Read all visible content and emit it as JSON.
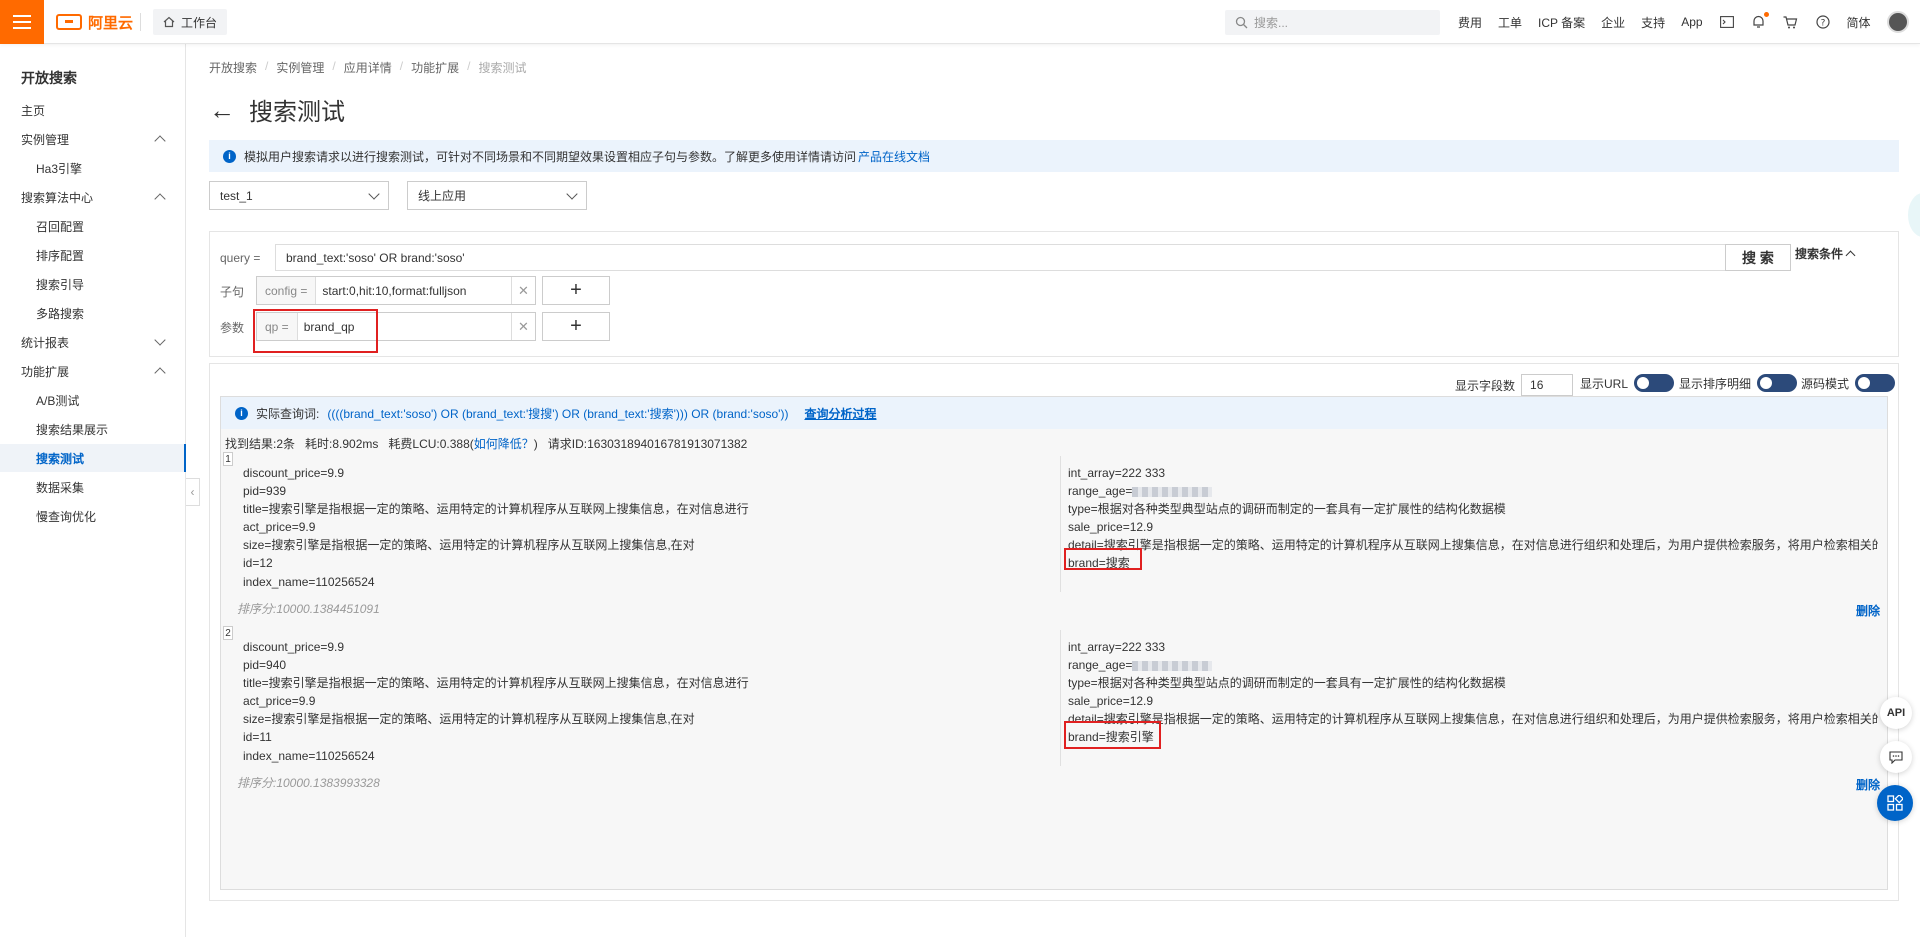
{
  "topbar": {
    "logo_text": "阿里云",
    "workbench_label": "工作台",
    "search_placeholder": "搜索...",
    "links": [
      "费用",
      "工单",
      "ICP 备案",
      "企业",
      "支持",
      "App"
    ],
    "lang": "简体"
  },
  "sidebar": {
    "title": "开放搜索",
    "items": [
      {
        "label": "主页",
        "sub": false,
        "chevron": ""
      },
      {
        "label": "实例管理",
        "sub": false,
        "chevron": "up"
      },
      {
        "label": "Ha3引擎",
        "sub": true,
        "chevron": ""
      },
      {
        "label": "搜索算法中心",
        "sub": false,
        "chevron": "up"
      },
      {
        "label": "召回配置",
        "sub": true,
        "chevron": ""
      },
      {
        "label": "排序配置",
        "sub": true,
        "chevron": ""
      },
      {
        "label": "搜索引导",
        "sub": true,
        "chevron": ""
      },
      {
        "label": "多路搜索",
        "sub": true,
        "chevron": ""
      },
      {
        "label": "统计报表",
        "sub": false,
        "chevron": "down"
      },
      {
        "label": "功能扩展",
        "sub": false,
        "chevron": "up"
      },
      {
        "label": "A/B测试",
        "sub": true,
        "chevron": ""
      },
      {
        "label": "搜索结果展示",
        "sub": true,
        "chevron": ""
      },
      {
        "label": "搜索测试",
        "sub": true,
        "chevron": "",
        "active": true
      },
      {
        "label": "数据采集",
        "sub": true,
        "chevron": ""
      },
      {
        "label": "慢查询优化",
        "sub": true,
        "chevron": ""
      }
    ]
  },
  "breadcrumb": [
    "开放搜索",
    "实例管理",
    "应用详情",
    "功能扩展",
    "搜索测试"
  ],
  "page_title": "搜索测试",
  "notice": {
    "text": "模拟用户搜索请求以进行搜索测试，可针对不同场景和不同期望效果设置相应子句与参数。了解更多使用详情请访问",
    "link": "产品在线文档"
  },
  "selects": {
    "app": "test_1",
    "env": "线上应用"
  },
  "query": {
    "label": "query =",
    "value": "brand_text:'soso' OR brand:'soso'",
    "search_button": "搜 索",
    "conditions_toggle": "搜索条件",
    "clause_label": "子句",
    "clause_key": "config =",
    "clause_value": "start:0,hit:10,format:fulljson",
    "param_label": "参数",
    "param_key": "qp =",
    "param_value": "brand_qp"
  },
  "controls": {
    "fields_label": "显示字段数",
    "fields_value": "16",
    "show_url": "显示URL",
    "show_sort": "显示排序明细",
    "source_mode": "源码模式"
  },
  "results": {
    "actual_query_label": "实际查询词:",
    "actual_query": "((((brand_text:'soso') OR (brand_text:'搜搜') OR (brand_text:'搜索'))) OR (brand:'soso'))",
    "analysis_link": "查询分析过程",
    "found": "找到结果:2条",
    "time": "耗时:8.902ms",
    "lcu_prefix": "耗费LCU:0.388(",
    "lcu_link": "如何降低？",
    "lcu_suffix": ")",
    "request_id": "请求ID:163031894016781913071382",
    "records": [
      {
        "num": "1",
        "left": [
          "discount_price=9.9",
          "pid=939",
          "title=搜索引擎是指根据一定的策略、运用特定的计算机程序从互联网上搜集信息，在对信息进行",
          "act_price=9.9",
          "size=搜索引擎是指根据一定的策略、运用特定的计算机程序从互联网上搜集信息,在对",
          "id=12",
          "index_name=110256524"
        ],
        "right_1": "int_array=222  333",
        "right_2": "range_age=",
        "right_3": "type=根据对各种类型典型站点的调研而制定的一套具有一定扩展性的结构化数据模",
        "right_4": "sale_price=12.9",
        "right_5": "detail=搜索引擎是指根据一定的策略、运用特定的计算机程序从互联网上搜集信息，在对信息进行组织和处理后，为用户提供检索服务，将用户检索相关的信息展示给用",
        "brand": "brand=搜索",
        "score": "排序分:10000.1384451091",
        "delete": "删除"
      },
      {
        "num": "2",
        "left": [
          "discount_price=9.9",
          "pid=940",
          "title=搜索引擎是指根据一定的策略、运用特定的计算机程序从互联网上搜集信息，在对信息进行",
          "act_price=9.9",
          "size=搜索引擎是指根据一定的策略、运用特定的计算机程序从互联网上搜集信息,在对",
          "id=11",
          "index_name=110256524"
        ],
        "right_1": "int_array=222  333",
        "right_2": "range_age=",
        "right_3": "type=根据对各种类型典型站点的调研而制定的一套具有一定扩展性的结构化数据模",
        "right_4": "sale_price=12.9",
        "right_5": "detail=搜索引擎是指根据一定的策略、运用特定的计算机程序从互联网上搜集信息，在对信息进行组织和处理后，为用户提供检索服务，将用户检索相关的信息展示给用",
        "brand": "brand=搜索引擎",
        "score": "排序分:10000.1383993328",
        "delete": "删除"
      }
    ]
  },
  "float_buttons": {
    "api": "API"
  },
  "colors": {
    "brand_orange": "#ff6a00",
    "link_blue": "#0064c8",
    "highlight_red": "#e02020"
  }
}
